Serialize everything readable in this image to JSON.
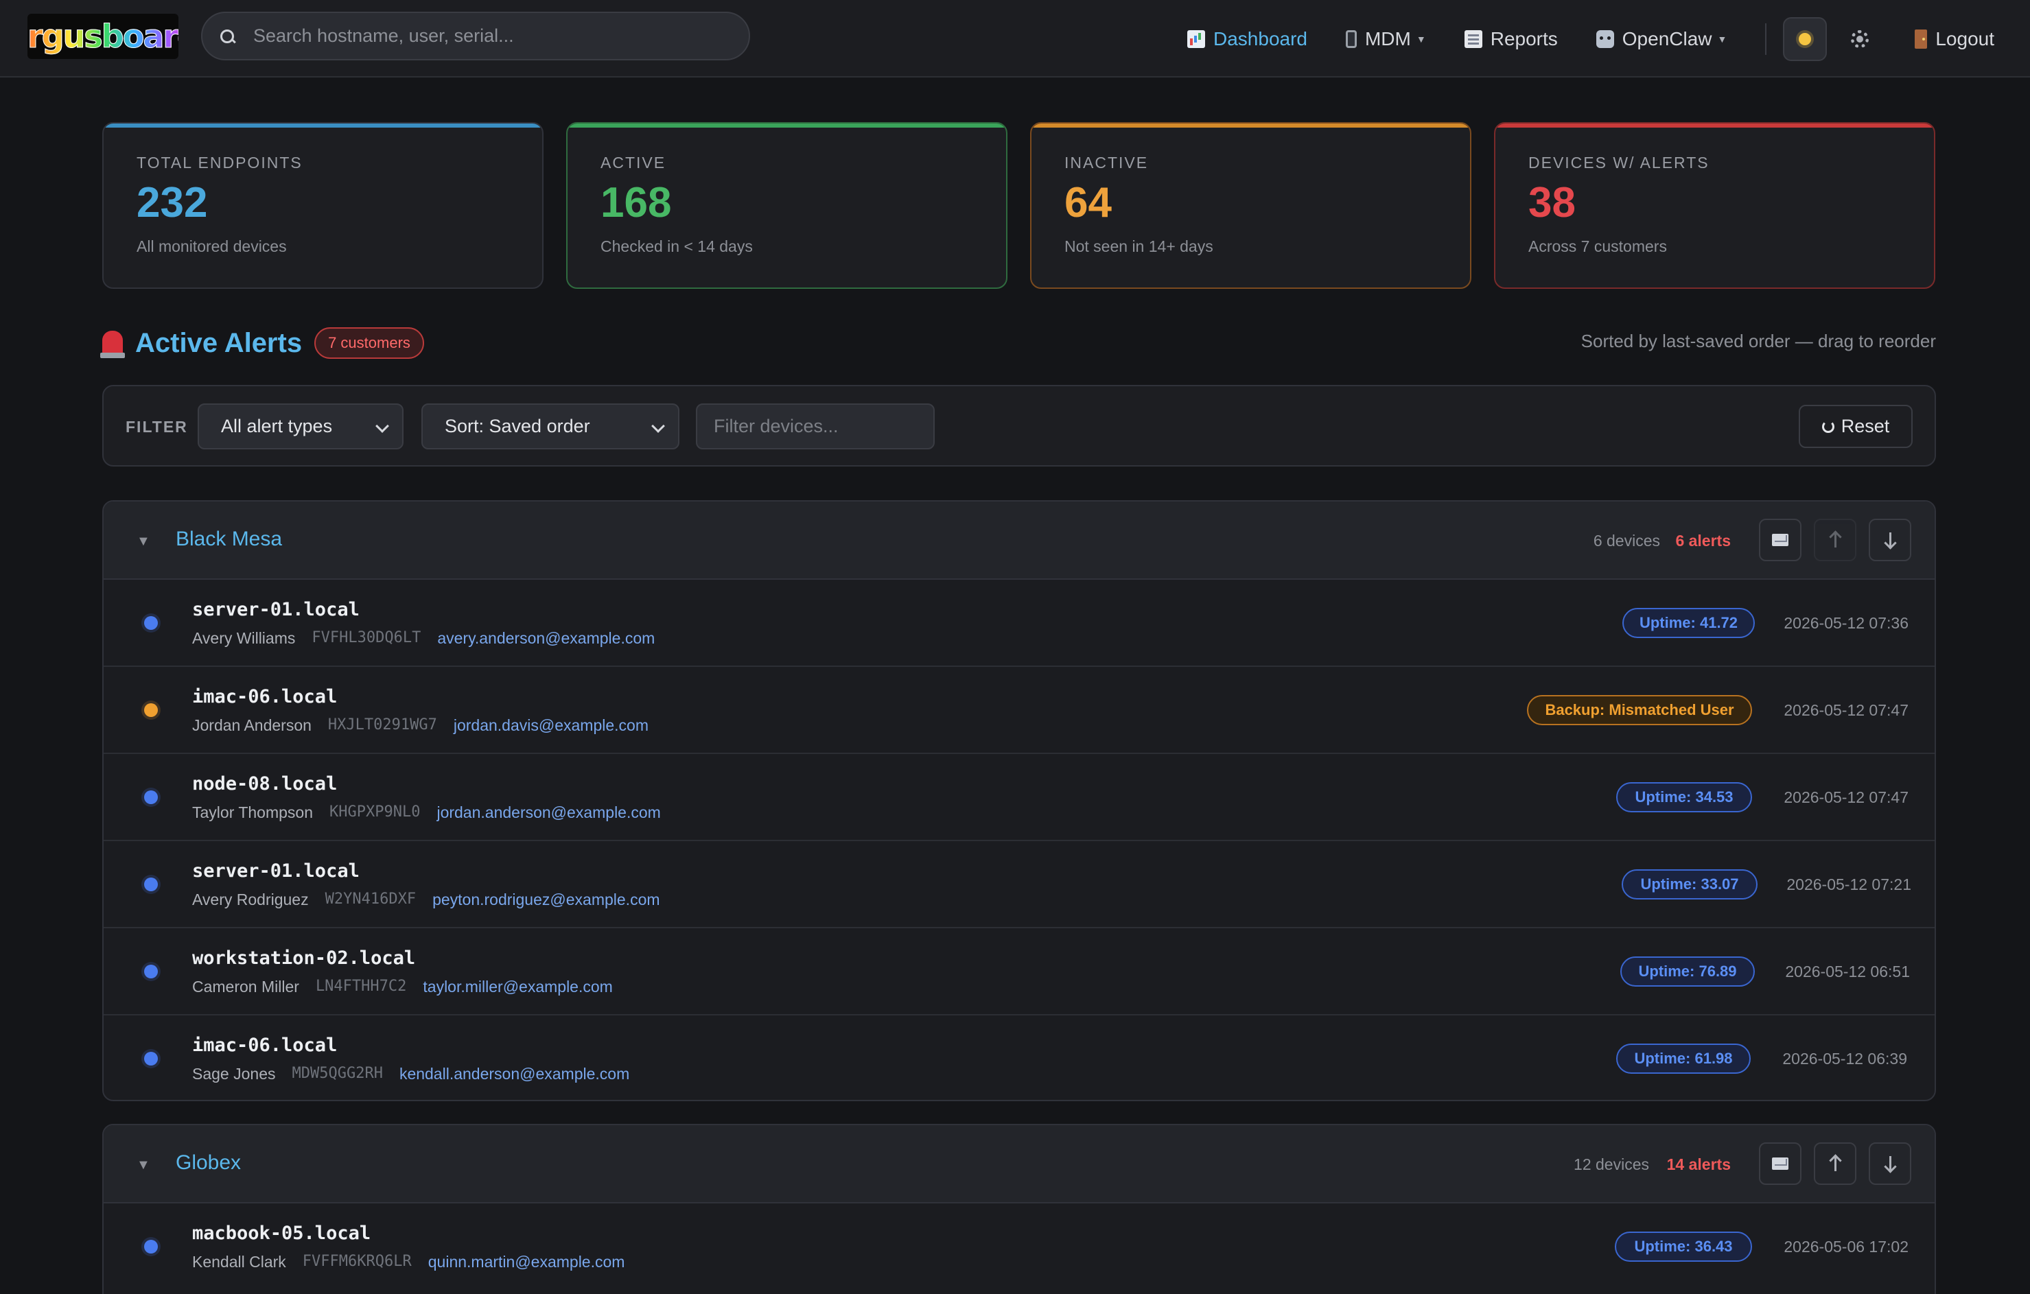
{
  "navbar": {
    "logo_text": "argusboard",
    "search_placeholder": "Search hostname, user, serial...",
    "items": [
      {
        "label": "Dashboard",
        "icon": "bar-chart-icon",
        "active": true
      },
      {
        "label": "MDM",
        "icon": "phone-icon",
        "dropdown": true
      },
      {
        "label": "Reports",
        "icon": "report-icon"
      },
      {
        "label": "OpenClaw",
        "icon": "robot-icon",
        "dropdown": true
      }
    ],
    "theme_icon": "sun-icon",
    "settings_icon": "gear-icon",
    "logout_label": "Logout"
  },
  "stats": [
    {
      "label": "TOTAL ENDPOINTS",
      "value": "232",
      "sub": "All monitored devices",
      "color": "#4aa8dc"
    },
    {
      "label": "ACTIVE",
      "value": "168",
      "sub": "Checked in < 14 days",
      "color": "#48b865"
    },
    {
      "label": "INACTIVE",
      "value": "64",
      "sub": "Not seen in 14+ days",
      "color": "#eea23c"
    },
    {
      "label": "DEVICES W/ ALERTS",
      "value": "38",
      "sub": "Across 7 customers",
      "color": "#e5484d"
    }
  ],
  "alerts": {
    "title": "Active Alerts",
    "badge": "7 customers",
    "sorted_note": "Sorted by last-saved order — drag to reorder"
  },
  "filter": {
    "label": "FILTER",
    "type_select": "All alert types",
    "sort_select": "Sort: Saved order",
    "device_placeholder": "Filter devices...",
    "reset_label": "Reset"
  },
  "groups": [
    {
      "name": "Black Mesa",
      "devices": "6 devices",
      "alerts": "6 alerts",
      "rows": [
        {
          "host": "server-01.local",
          "user": "Avery Williams",
          "serial": "FVFHL30DQ6LT",
          "email": "avery.anderson@example.com",
          "status": "blue",
          "pill": "Uptime: 41.72",
          "pill_type": "uptime",
          "time": "2026-05-12 07:36"
        },
        {
          "host": "imac-06.local",
          "user": "Jordan Anderson",
          "serial": "HXJLT0291WG7",
          "email": "jordan.davis@example.com",
          "status": "orange",
          "pill": "Backup: Mismatched User",
          "pill_type": "backup",
          "time": "2026-05-12 07:47"
        },
        {
          "host": "node-08.local",
          "user": "Taylor Thompson",
          "serial": "KHGPXP9NL0",
          "email": "jordan.anderson@example.com",
          "status": "blue",
          "pill": "Uptime: 34.53",
          "pill_type": "uptime",
          "time": "2026-05-12 07:47"
        },
        {
          "host": "server-01.local",
          "user": "Avery Rodriguez",
          "serial": "W2YN416DXF",
          "email": "peyton.rodriguez@example.com",
          "status": "blue",
          "pill": "Uptime: 33.07",
          "pill_type": "uptime",
          "time": "2026-05-12 07:21"
        },
        {
          "host": "workstation-02.local",
          "user": "Cameron Miller",
          "serial": "LN4FTHH7C2",
          "email": "taylor.miller@example.com",
          "status": "blue",
          "pill": "Uptime: 76.89",
          "pill_type": "uptime",
          "time": "2026-05-12 06:51"
        },
        {
          "host": "imac-06.local",
          "user": "Sage Jones",
          "serial": "MDW5QGG2RH",
          "email": "kendall.anderson@example.com",
          "status": "blue",
          "pill": "Uptime: 61.98",
          "pill_type": "uptime",
          "time": "2026-05-12 06:39"
        }
      ]
    },
    {
      "name": "Globex",
      "devices": "12 devices",
      "alerts": "14 alerts",
      "rows": [
        {
          "host": "macbook-05.local",
          "user": "Kendall Clark",
          "serial": "FVFFM6KRQ6LR",
          "email": "quinn.martin@example.com",
          "status": "blue",
          "pill": "Uptime: 36.43",
          "pill_type": "uptime",
          "time": "2026-05-06 17:02"
        }
      ]
    }
  ]
}
